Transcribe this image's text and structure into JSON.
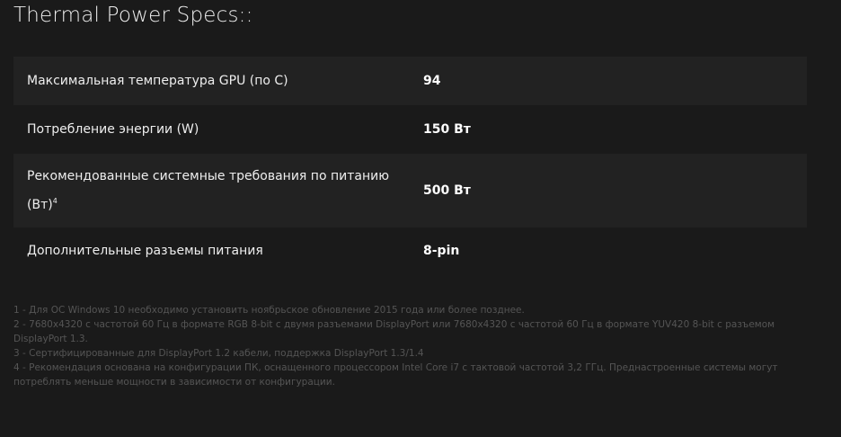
{
  "title": "Thermal Power Specs::",
  "specs": [
    {
      "label": "Максимальная температура GPU (по C)",
      "value": "94"
    },
    {
      "label": "Потребление энергии (W)",
      "value": "150 Вт"
    },
    {
      "label": "Рекомендованные системные требования по питанию (Вт)",
      "label_sup": "4",
      "value": "500 Вт"
    },
    {
      "label": "Дополнительные разъемы питания",
      "value": "8-pin"
    }
  ],
  "footnotes": [
    "1 - Для ОС Windows 10 необходимо установить ноябрьское обновление 2015 года или более позднее.",
    "2 - 7680x4320 с частотой 60 Гц в формате RGB 8-bit с двумя разъемами DisplayPort или 7680x4320 с частотой 60 Гц в формате YUV420 8-bit с разъемом DisplayPort 1.3.",
    "3 - Сертифицированные для DisplayPort 1.2 кабели, поддержка DisplayPort 1.3/1.4",
    "4 - Рекомендация основана на конфигурации ПК, оснащенного процессором Intel Core i7 с тактовой частотой 3,2 ГГц. Преднастроенные системы могут потреблять меньше мощности в зависимости от конфигурации."
  ]
}
